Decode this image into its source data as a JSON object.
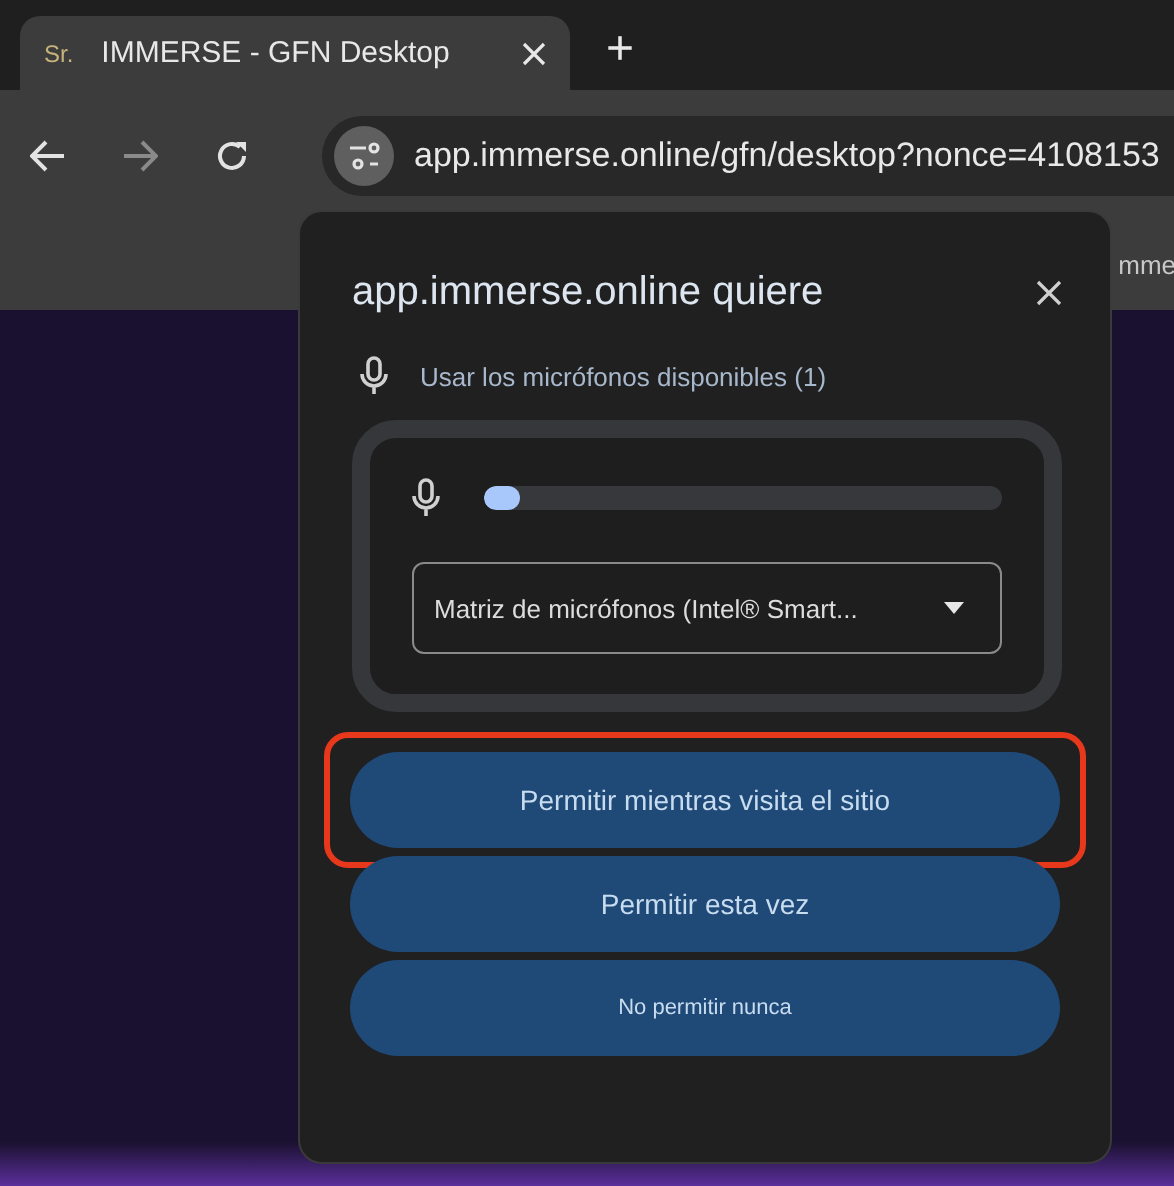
{
  "tab": {
    "favicon_text": "Sr.",
    "title": "IMMERSE - GFN Desktop",
    "selected": true
  },
  "new_tab": "+",
  "address_bar": {
    "url": "app.immerse.online/gfn/desktop?nonce=4108153"
  },
  "bookmarks_bar": {
    "partial_text": "mme"
  },
  "permission_popup": {
    "title": "app.immerse.online quiere",
    "permission": "Usar los micrófonos disponibles (1)",
    "mic_level": {
      "level": 0.05
    },
    "device_select": {
      "value": "Matriz de micrófonos (Intel® Smart..."
    },
    "buttons": [
      {
        "label": "Permitir mientras visita el sitio",
        "highlighted": true,
        "kind": "regular"
      },
      {
        "label": "Permitir esta vez",
        "highlighted": false,
        "kind": "regular"
      },
      {
        "label": "No permitir nunca",
        "highlighted": false,
        "kind": "compact"
      }
    ]
  }
}
